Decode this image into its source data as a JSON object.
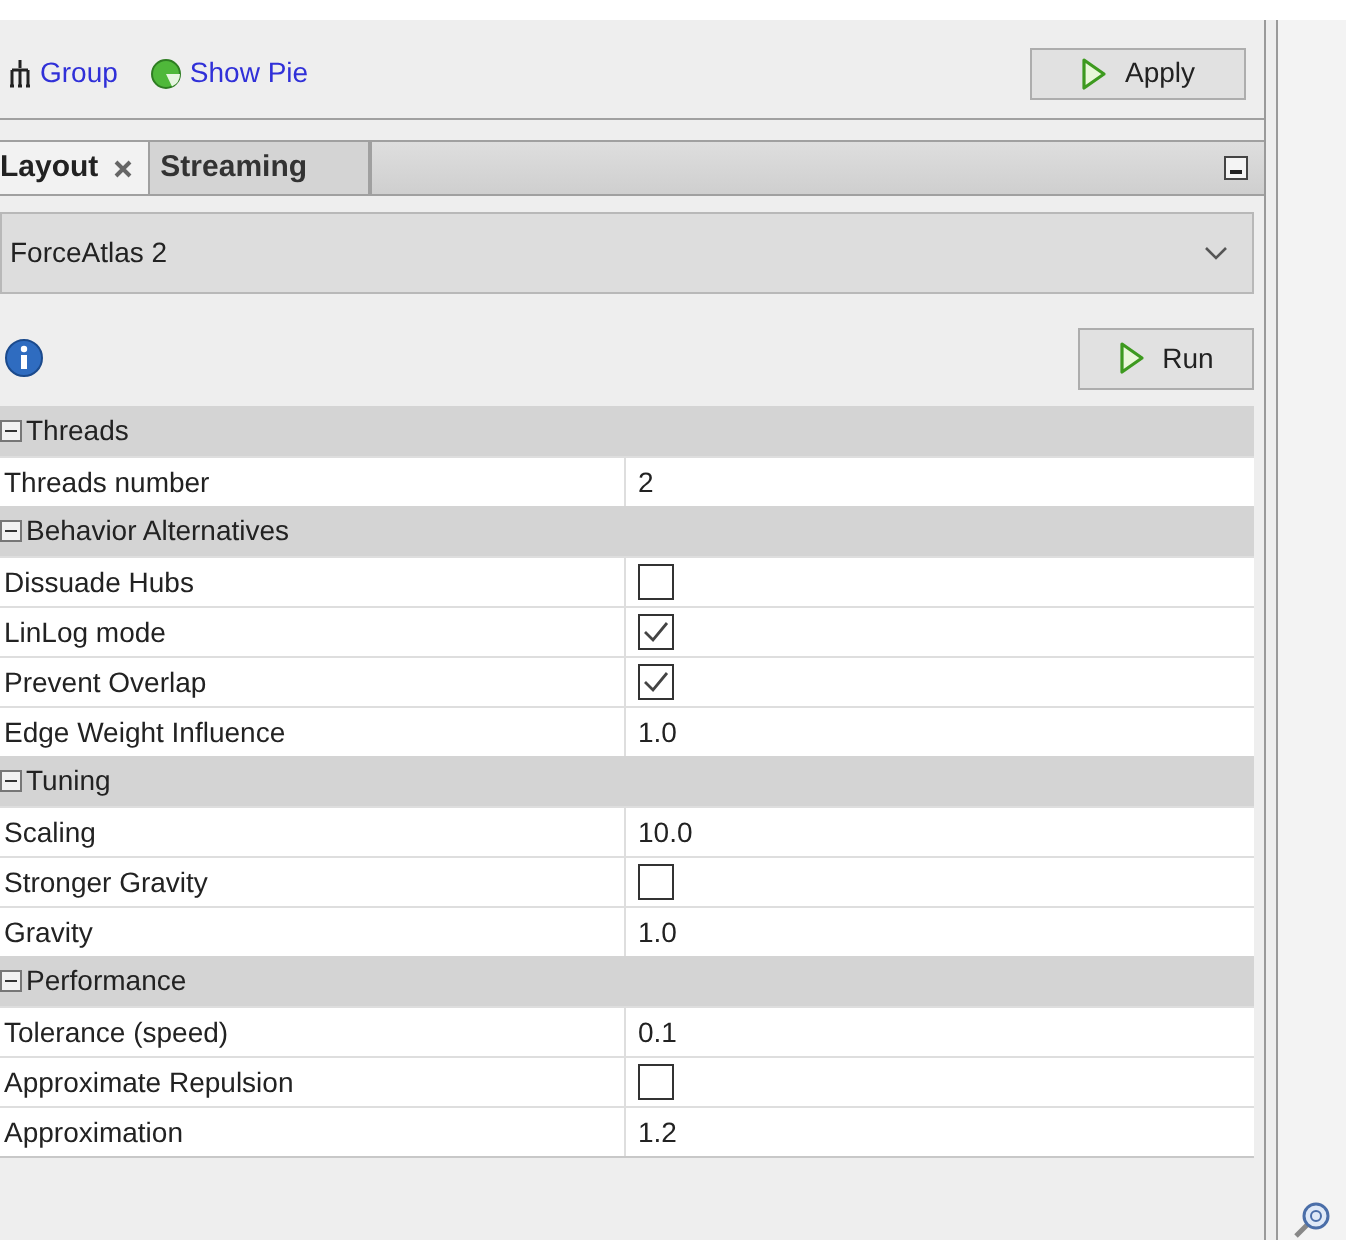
{
  "toolbar": {
    "links": [
      {
        "label": "Group",
        "kind": "group"
      },
      {
        "label": "Show Pie",
        "kind": "pie"
      }
    ],
    "apply_button": "Apply"
  },
  "tabs": [
    {
      "label": "Layout",
      "selected": true,
      "closable": true
    },
    {
      "label": "Streaming",
      "selected": false,
      "closable": false
    }
  ],
  "layout_select": {
    "value": "ForceAtlas 2"
  },
  "run_button": "Run",
  "properties": [
    {
      "title": "Threads",
      "expanded": true,
      "rows": [
        {
          "name": "Threads number",
          "kind": "text",
          "value": "2"
        }
      ]
    },
    {
      "title": "Behavior Alternatives",
      "expanded": true,
      "rows": [
        {
          "name": "Dissuade Hubs",
          "kind": "checkbox",
          "checked": false
        },
        {
          "name": "LinLog mode",
          "kind": "checkbox",
          "checked": true
        },
        {
          "name": "Prevent Overlap",
          "kind": "checkbox",
          "checked": true
        },
        {
          "name": "Edge Weight Influence",
          "kind": "text",
          "value": "1.0"
        }
      ]
    },
    {
      "title": "Tuning",
      "expanded": true,
      "rows": [
        {
          "name": "Scaling",
          "kind": "text",
          "value": "10.0"
        },
        {
          "name": "Stronger Gravity",
          "kind": "checkbox",
          "checked": false
        },
        {
          "name": "Gravity",
          "kind": "text",
          "value": "1.0"
        }
      ]
    },
    {
      "title": "Performance",
      "expanded": true,
      "rows": [
        {
          "name": "Tolerance (speed)",
          "kind": "text",
          "value": "0.1"
        },
        {
          "name": "Approximate Repulsion",
          "kind": "checkbox",
          "checked": false
        },
        {
          "name": "Approximation",
          "kind": "text",
          "value": "1.2"
        }
      ]
    }
  ]
}
